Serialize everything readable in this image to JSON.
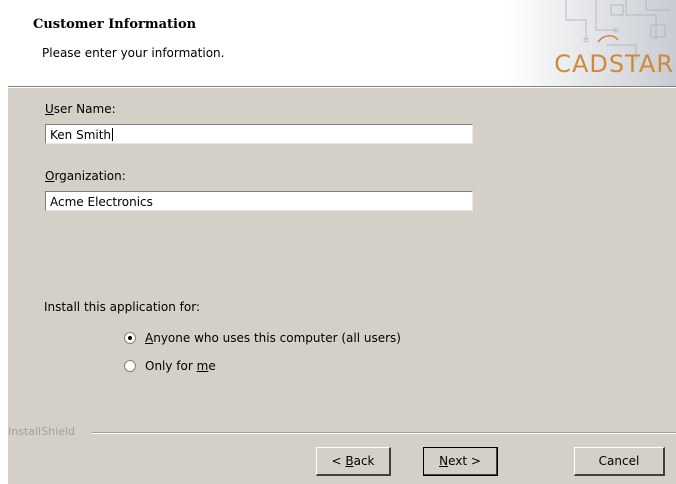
{
  "header": {
    "title": "Customer Information",
    "subtitle": "Please enter your information.",
    "logo_text": "CADSTAR"
  },
  "form": {
    "user_name_label_mnemonic": "U",
    "user_name_label_rest": "ser Name:",
    "user_name_value": "Ken Smith",
    "organization_label_mnemonic": "O",
    "organization_label_rest": "rganization:",
    "organization_value": "Acme Electronics"
  },
  "install_for": {
    "label": "Install this application for:",
    "options": [
      {
        "mnemonic": "A",
        "rest": "nyone who uses this computer (all users)",
        "selected": true
      },
      {
        "prefix": "Only for ",
        "mnemonic": "m",
        "rest": "e",
        "selected": false
      }
    ]
  },
  "footer": {
    "brand": "InstallShield",
    "back_prefix": "< ",
    "back_mnemonic": "B",
    "back_rest": "ack",
    "next_mnemonic": "N",
    "next_rest": "ext >",
    "cancel_label": "Cancel"
  },
  "colors": {
    "dialog_bg": "#d4d0c8",
    "logo": "#d0883a"
  }
}
